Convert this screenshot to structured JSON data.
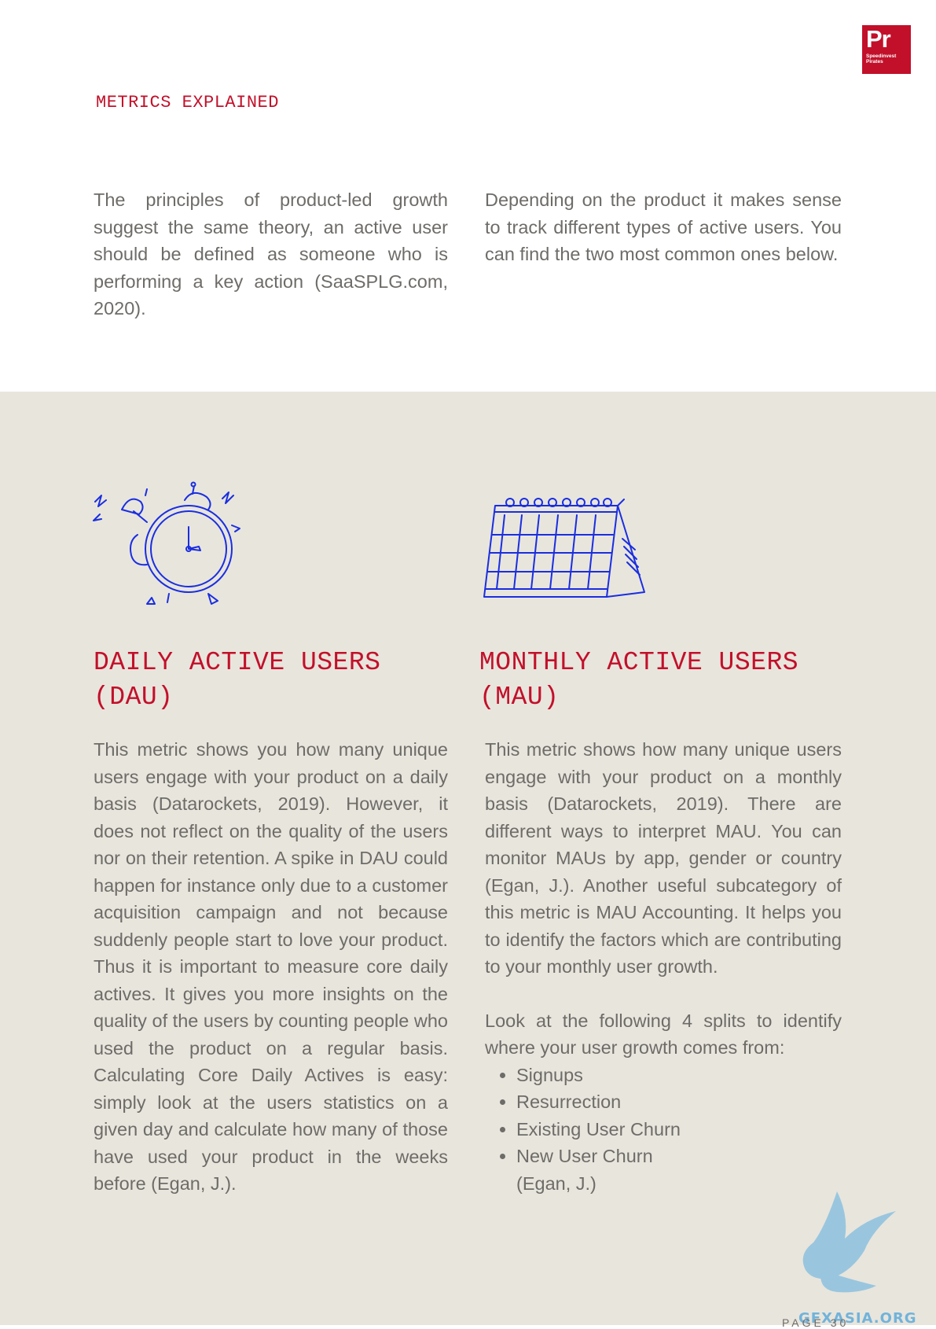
{
  "logo": {
    "mark": "Pr",
    "line1": "Speedinvest",
    "line2": "Pirates"
  },
  "section_label": "METRICS EXPLAINED",
  "intro": {
    "left": "The principles of product-led growth suggest the same theory, an active user should be defined as someone who is performing a key action (SaaSPLG.com, 2020).",
    "right": "Depending on the product it makes sense to track different types of active users. You can find the two most common ones below."
  },
  "icons": {
    "left": "alarm-clock-icon",
    "right": "desk-calendar-icon"
  },
  "colors": {
    "accent": "#c2102a",
    "band": "#e8e5dd",
    "icon_stroke": "#1a2ee0",
    "text": "#6e6c68"
  },
  "dau": {
    "title_line1": "DAILY ACTIVE USERS",
    "title_line2": "(DAU)",
    "body": "This metric shows you how many unique users engage with your product on a daily basis (Datarockets, 2019). However, it does not reflect on the quality of the users nor on their retention. A spike in DAU could happen for instance only due to a customer acquisition campaign and not because suddenly people start to love your product. Thus it is important to measure core daily actives. It gives you more insights on the quality of the users by counting people who used the product on a regular basis. Calculating Core Daily Actives is easy: simply look at the users statistics on a given day and calculate how many of those have used your product in the weeks before (Egan, J.)."
  },
  "mau": {
    "title_line1": "MONTHLY ACTIVE USERS",
    "title_line2": "(MAU)",
    "body": "This metric shows how many unique users engage with your product on a monthly basis (Datarockets, 2019). There are different ways to interpret MAU. You can monitor MAUs by app, gender or country (Egan, J.). Another useful subcategory of this metric is MAU Accounting. It helps you to identify the factors which are contributing to your monthly user growth.",
    "splits_intro": "Look at the following 4 splits to identify where your user growth comes from:",
    "splits": [
      "Signups",
      "Resurrection",
      "Existing User Churn",
      "New User Churn"
    ],
    "citation": "(Egan, J.)"
  },
  "footer": {
    "page_label": "PAGE 30"
  },
  "watermark": {
    "text": "GFXASIA.ORG"
  }
}
